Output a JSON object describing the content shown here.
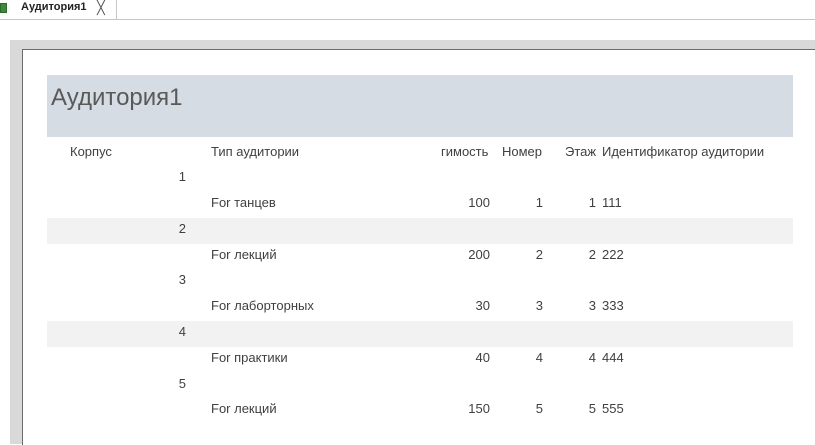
{
  "tab": {
    "label": "Аудитория1",
    "close": "╳"
  },
  "report": {
    "title": "Аудитория1",
    "headers": {
      "korpus": "Корпус",
      "type": "Тип аудитории",
      "capacity": "гимость",
      "number": "Номер",
      "floor": "Этаж",
      "id": "Идентификатор аудитории"
    },
    "groups": [
      {
        "korpus": "1",
        "type": "For танцев",
        "capacity": "100",
        "number": "1",
        "floor": "1",
        "id": "111"
      },
      {
        "korpus": "2",
        "type": "For лекций",
        "capacity": "200",
        "number": "2",
        "floor": "2",
        "id": "222"
      },
      {
        "korpus": "3",
        "type": "For лаборторных",
        "capacity": "30",
        "number": "3",
        "floor": "3",
        "id": "333"
      },
      {
        "korpus": "4",
        "type": "For практики",
        "capacity": "40",
        "number": "4",
        "floor": "4",
        "id": "444"
      },
      {
        "korpus": "5",
        "type": "For лекций",
        "capacity": "150",
        "number": "5",
        "floor": "5",
        "id": "555"
      }
    ]
  }
}
